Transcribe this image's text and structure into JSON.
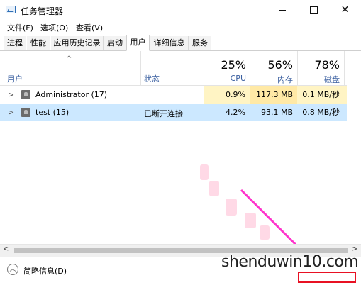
{
  "window": {
    "title": "任务管理器"
  },
  "menu": [
    "文件(F)",
    "选项(O)",
    "查看(V)"
  ],
  "tabs": [
    "进程",
    "性能",
    "应用历史记录",
    "启动",
    "用户",
    "详细信息",
    "服务"
  ],
  "active_tab": "用户",
  "columns": {
    "name": "用户",
    "status": "状态",
    "cpu": {
      "percent": "25%",
      "label": "CPU"
    },
    "memory": {
      "percent": "56%",
      "label": "内存"
    },
    "disk": {
      "percent": "78%",
      "label": "磁盘"
    }
  },
  "rows": [
    {
      "name": "Administrator (17)",
      "status": "",
      "cpu": "0.9%",
      "memory": "117.3 MB",
      "disk": "0.1 MB/秒",
      "selected": false
    },
    {
      "name": "test (15)",
      "status": "已断开连接",
      "cpu": "4.2%",
      "memory": "93.1 MB",
      "disk": "0.8 MB/秒",
      "selected": true
    }
  ],
  "footer": {
    "less_details": "简略信息(D)"
  },
  "watermark": "shenduwin10.com",
  "colors": {
    "cpu_cell": "#fff4c4",
    "mem_cell": "#ffe9a6",
    "disk_cell": "#fff4c4",
    "selected_row": "#cce8ff",
    "arrow": "#ff33cc",
    "highlight_box": "#e81123"
  }
}
